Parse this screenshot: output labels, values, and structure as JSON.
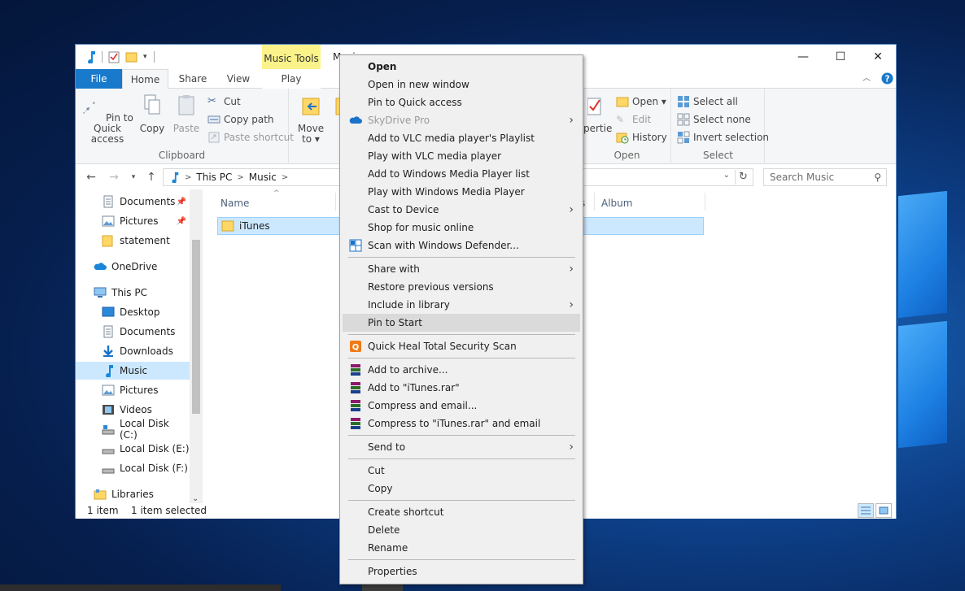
{
  "window": {
    "title": "Music",
    "contextual_tab_group": "Music Tools",
    "tabs": [
      "File",
      "Home",
      "Share",
      "View",
      "Play"
    ],
    "controls": {
      "minimize": "—",
      "maximize": "☐",
      "close": "✕"
    }
  },
  "ribbon": {
    "clipboard": {
      "label": "Clipboard",
      "pin": "Pin to Quick access",
      "copy": "Copy",
      "paste": "Paste",
      "cut": "Cut",
      "copy_path": "Copy path",
      "paste_shortcut": "Paste shortcut"
    },
    "organize": {
      "move_to": "Move to"
    },
    "open": {
      "label": "Open",
      "properties_partial": "perties",
      "open": "Open",
      "edit": "Edit",
      "history": "History"
    },
    "select": {
      "label": "Select",
      "select_all": "Select all",
      "select_none": "Select none",
      "invert": "Invert selection"
    }
  },
  "address": {
    "crumbs": [
      "This PC",
      "Music"
    ],
    "search_placeholder": "Search Music"
  },
  "nav": {
    "items": [
      {
        "label": "Documents",
        "icon": "documents-icon"
      },
      {
        "label": "Pictures",
        "icon": "pictures-icon"
      },
      {
        "label": "statement",
        "icon": "folder-icon"
      },
      {
        "label": "OneDrive",
        "icon": "onedrive-icon"
      },
      {
        "label": "This PC",
        "icon": "pc-icon"
      },
      {
        "label": "Desktop",
        "icon": "desktop-icon"
      },
      {
        "label": "Documents",
        "icon": "documents-icon"
      },
      {
        "label": "Downloads",
        "icon": "downloads-icon"
      },
      {
        "label": "Music",
        "icon": "music-icon"
      },
      {
        "label": "Pictures",
        "icon": "pictures-icon"
      },
      {
        "label": "Videos",
        "icon": "videos-icon"
      },
      {
        "label": "Local Disk (C:)",
        "icon": "disk-icon"
      },
      {
        "label": "Local Disk (E:)",
        "icon": "disk-icon"
      },
      {
        "label": "Local Disk (F:)",
        "icon": "disk-icon"
      },
      {
        "label": "Libraries",
        "icon": "libraries-icon"
      }
    ]
  },
  "content": {
    "columns": [
      "Name",
      "s",
      "Album"
    ],
    "rows": [
      {
        "name": "iTunes"
      }
    ]
  },
  "status": {
    "count": "1 item",
    "selected": "1 item selected"
  },
  "context_menu": {
    "items": [
      "Open",
      "Open in new window",
      "Pin to Quick access",
      "SkyDrive Pro",
      "Add to VLC media player's Playlist",
      "Play with VLC media player",
      "Add to Windows Media Player list",
      "Play with Windows Media Player",
      "Cast to Device",
      "Shop for music online",
      "Scan with Windows Defender...",
      "Share with",
      "Restore previous versions",
      "Include in library",
      "Pin to Start",
      "Quick Heal Total Security Scan",
      "Add to archive...",
      "Add to \"iTunes.rar\"",
      "Compress and email...",
      "Compress to \"iTunes.rar\" and email",
      "Send to",
      "Cut",
      "Copy",
      "Create shortcut",
      "Delete",
      "Rename",
      "Properties"
    ],
    "highlighted": "Pin to Start"
  },
  "colors": {
    "accent": "#1979ca",
    "music_tools": "#fbf38a",
    "selection": "#cce8ff"
  }
}
